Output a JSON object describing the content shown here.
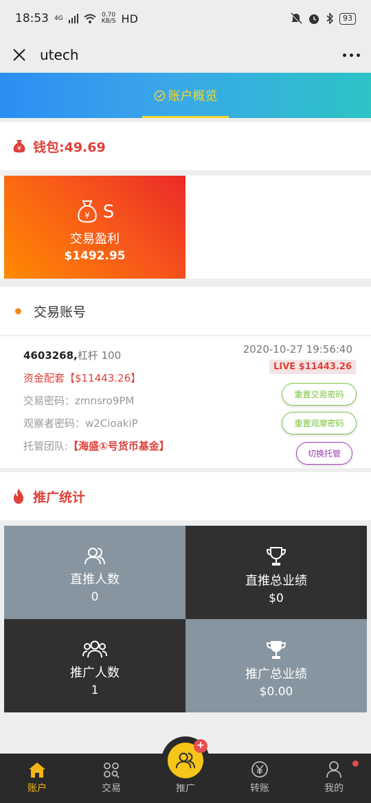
{
  "status_bar": {
    "time": "18:53",
    "network": "4G",
    "speed_value": "0.70",
    "speed_unit": "KB/S",
    "hd": "HD",
    "battery": "93"
  },
  "nav": {
    "title": "utech"
  },
  "tabs": {
    "active_label": "账户概览"
  },
  "wallet": {
    "label": "钱包:49.69"
  },
  "profit": {
    "symbol": "S",
    "label": "交易盈利",
    "value": "$1492.95"
  },
  "trading_section": {
    "title": "交易账号"
  },
  "account": {
    "number": "4603268,",
    "leverage": "杠杆 100",
    "capital": "资金配套【$11443.26】",
    "trade_password": "交易密码：zmnsro9PM",
    "observer_password": "观察者密码：w2CioakiP",
    "team_label": "托管团队:",
    "team_name": "【海盛①号货币基金】",
    "timestamp": "2020-10-27 19:56:40",
    "live_badge": "LIVE $11443.26",
    "reset_trade_btn": "重置交易密码",
    "reset_observer_btn": "重置观摩密码",
    "switch_btn": "切换托管"
  },
  "promo": {
    "title": "推广统计",
    "stats": [
      {
        "label": "直推人数",
        "value": "0",
        "icon": "users-icon"
      },
      {
        "label": "直推总业绩",
        "value": "$0",
        "icon": "trophy-outline-icon"
      },
      {
        "label": "推广人数",
        "value": "1",
        "icon": "group-icon"
      },
      {
        "label": "推广总业绩",
        "value": "$0.00",
        "icon": "trophy-filled-icon"
      }
    ]
  },
  "bottom_nav": {
    "items": [
      {
        "label": "账户",
        "icon": "home-icon",
        "active": true
      },
      {
        "label": "交易",
        "icon": "grid-search-icon",
        "active": false
      },
      {
        "label": "推广",
        "icon": "users-icon",
        "active": false
      },
      {
        "label": "转账",
        "icon": "yen-circle-icon",
        "active": false
      },
      {
        "label": "我的",
        "icon": "person-icon",
        "active": false
      }
    ],
    "plus": "+"
  },
  "colors": {
    "accent": "#f4d62c",
    "red": "#e0403a",
    "green": "#7cc340",
    "purple": "#a03bb5"
  }
}
